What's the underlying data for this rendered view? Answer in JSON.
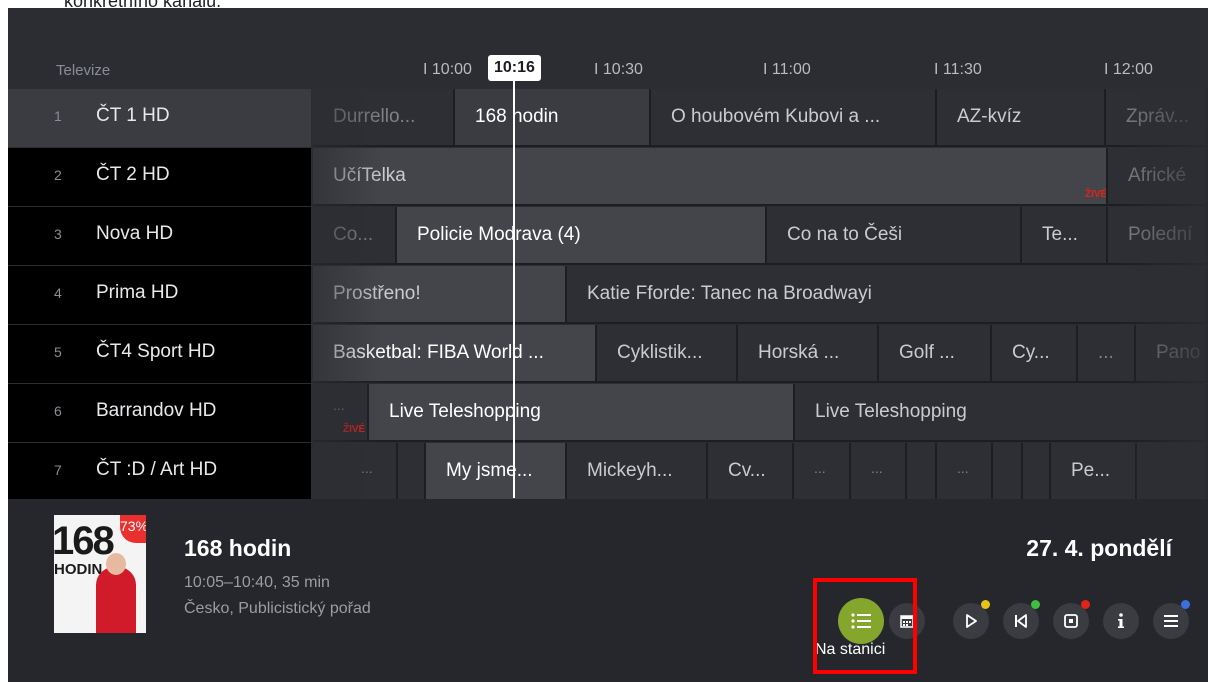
{
  "caption": "konkrétního kanálu.",
  "header": {
    "section_label": "Televize",
    "now_time": "10:16",
    "ticks": [
      "I 10:00",
      "I 10:30",
      "I 11:00",
      "I 11:30",
      "I 12:00"
    ]
  },
  "channels": [
    {
      "num": "1",
      "name": "ČT 1 HD"
    },
    {
      "num": "2",
      "name": "ČT 2 HD"
    },
    {
      "num": "3",
      "name": "Nova HD"
    },
    {
      "num": "4",
      "name": "Prima HD"
    },
    {
      "num": "5",
      "name": "ČT4 Sport HD"
    },
    {
      "num": "6",
      "name": "Barrandov HD"
    },
    {
      "num": "7",
      "name": "ČT :D / Art HD"
    }
  ],
  "programs": {
    "ct1": [
      "Durrello...",
      "168 hodin",
      "O houbovém Kubovi a ...",
      "AZ-kvíz",
      "Zpráv..."
    ],
    "ct2": [
      "UčíTelka",
      "Africké"
    ],
    "nova": [
      "Co...",
      "Policie Modrava (4)",
      "Co na to Češi",
      "Te...",
      "Polední"
    ],
    "prima": [
      "Prostřeno!",
      "Katie Fforde: Tanec na Broadwayi"
    ],
    "sport": [
      "Basketbal: FIBA World ...",
      "Cyklistik...",
      "Horská ...",
      "Golf ...",
      "Cy...",
      "...",
      "Pano"
    ],
    "barrandov": [
      "...",
      "Live Teleshopping",
      "Live Teleshopping"
    ],
    "ctd": [
      "...",
      "My jsme...",
      "Mickeyh...",
      "Cv...",
      "...",
      "...",
      "...",
      "Pe..."
    ]
  },
  "live_label": "ŽIVÉ",
  "detail": {
    "poster_text": "168",
    "poster_sub": "HODIN",
    "progress_percent": "73%",
    "title": "168 hodin",
    "time": "10:05–10:40, 35 min",
    "meta": "Česko, Publicistický pořad",
    "date": "27. 4. pondělí"
  },
  "buttons": {
    "na_stanici_label": "Na stanici"
  },
  "colors": {
    "accent_green": "#85a62c",
    "highlight_red": "#ff0000",
    "live_red": "#e2231a",
    "dot_yellow": "#e8c21a",
    "dot_green": "#3fbf3f",
    "dot_red": "#e2231a",
    "dot_blue": "#3b6fe0"
  }
}
